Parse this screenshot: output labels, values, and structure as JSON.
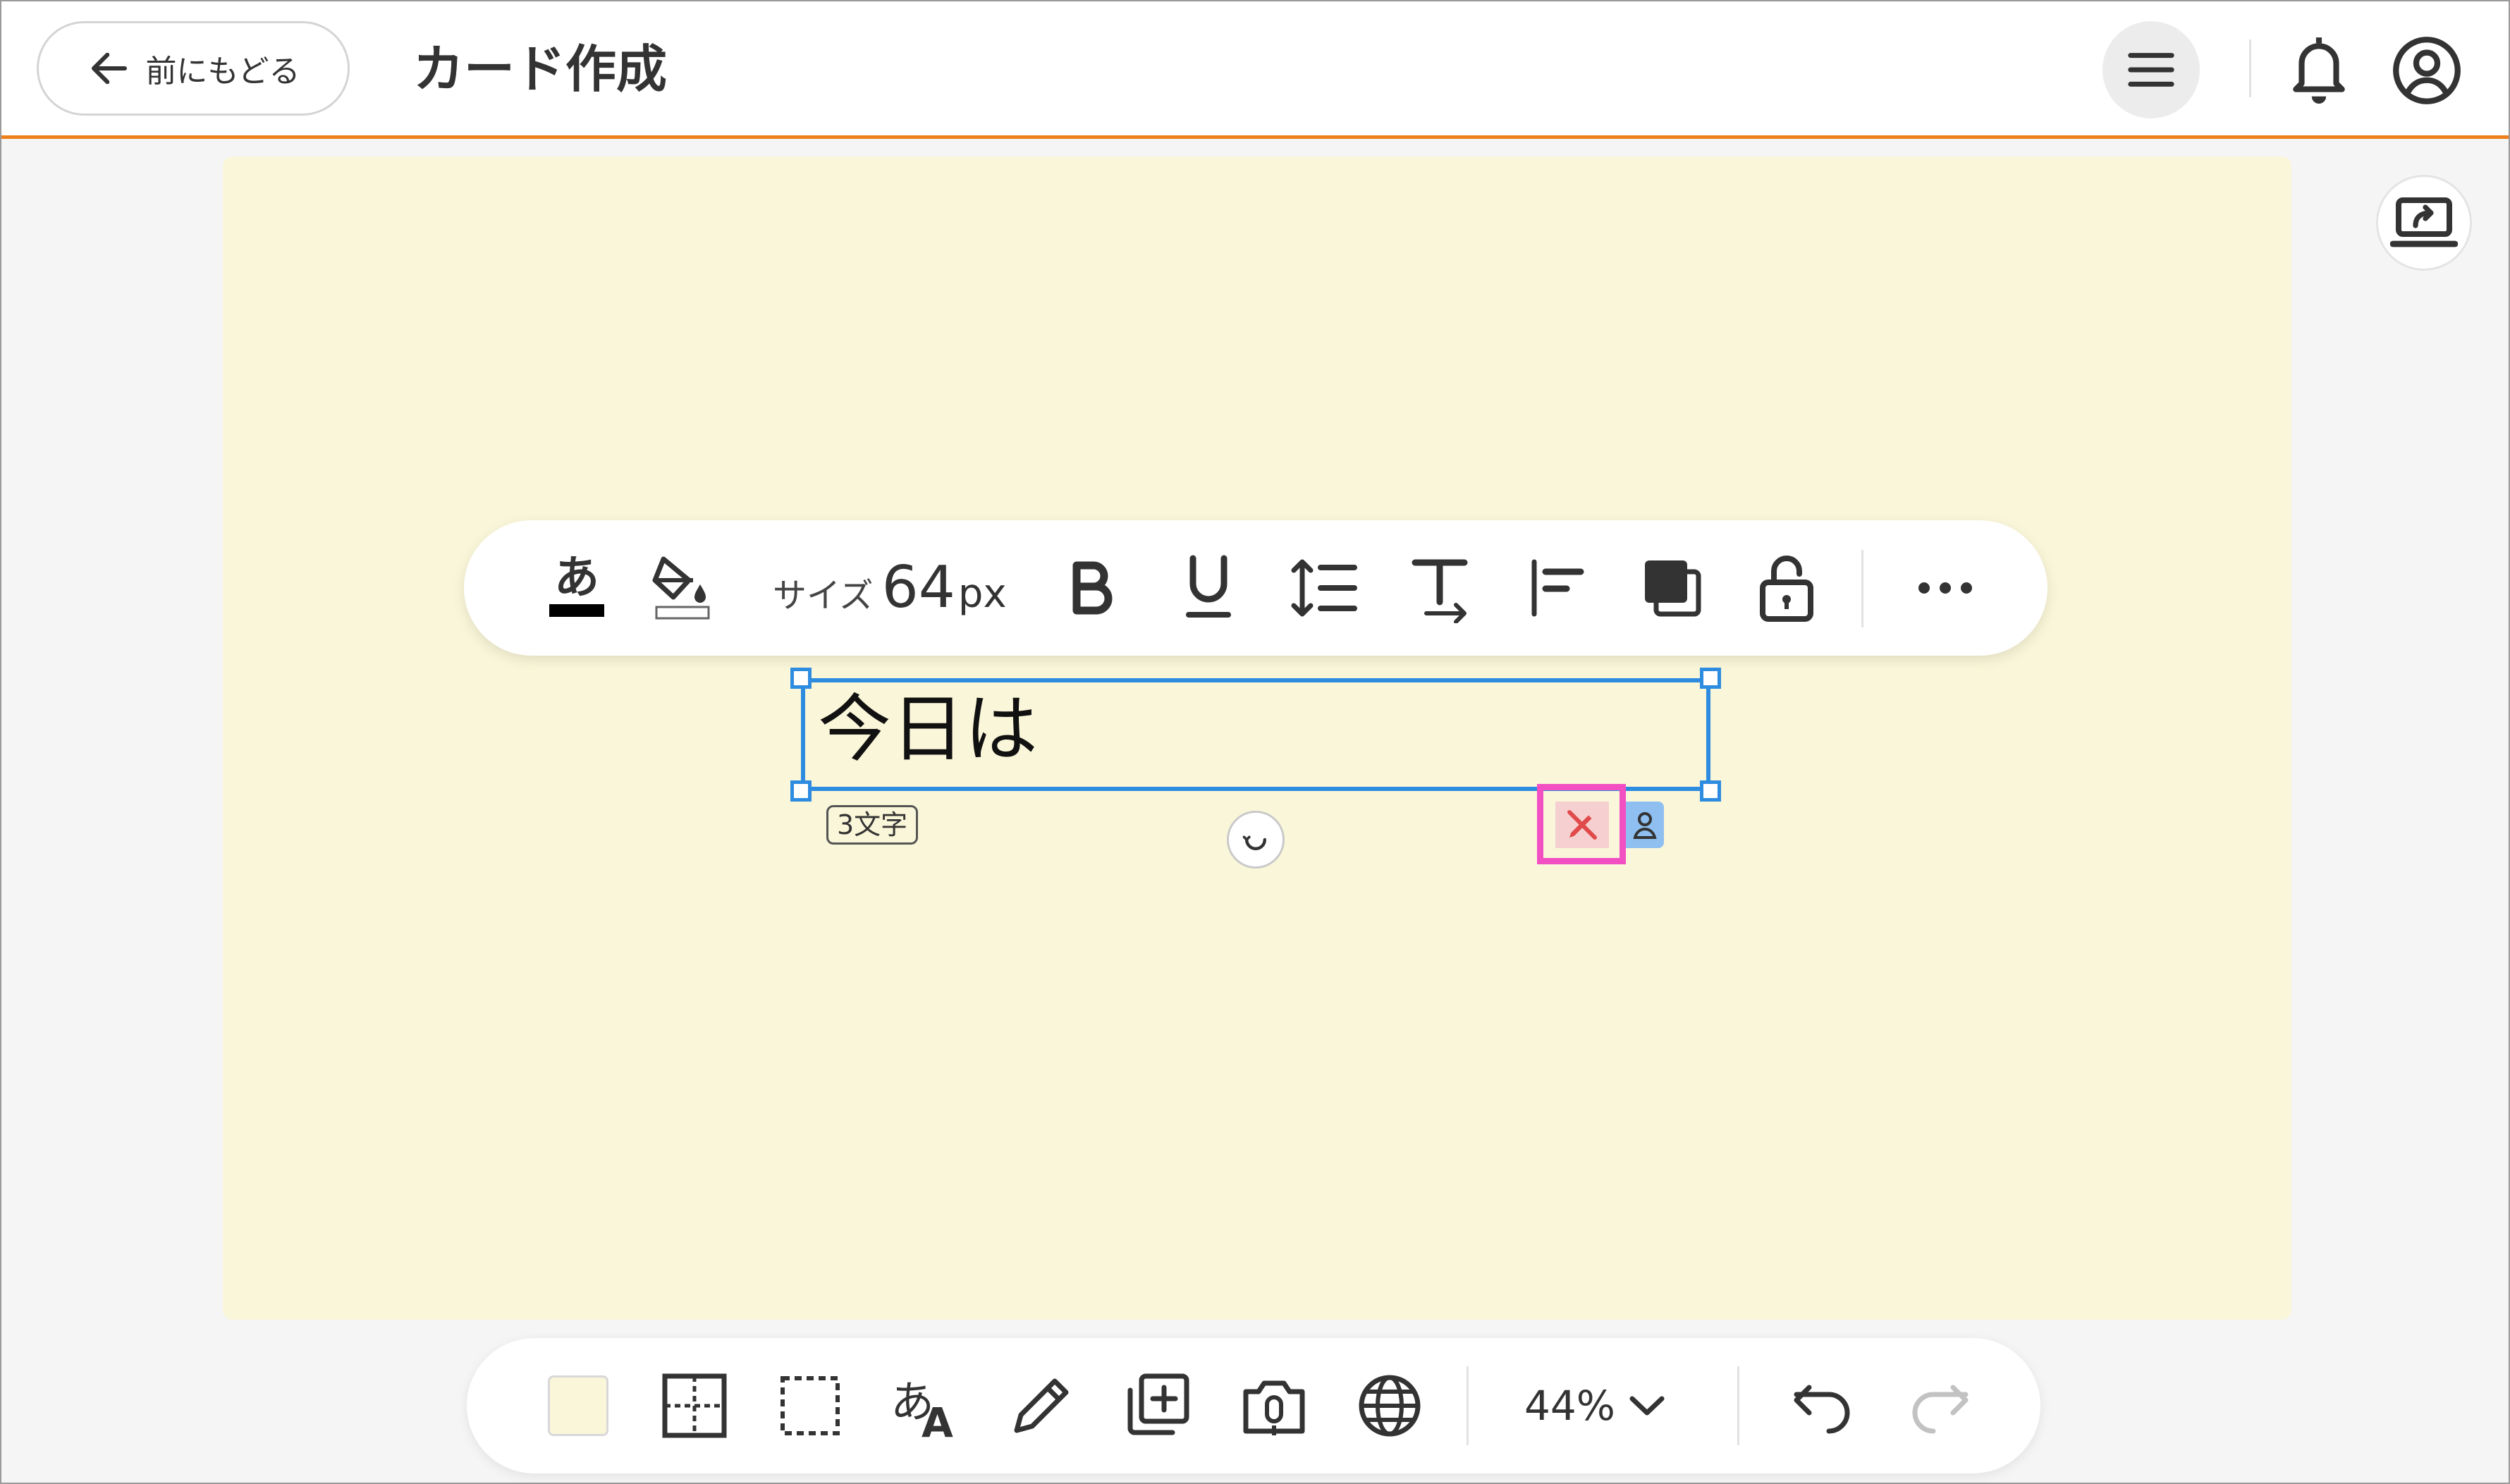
{
  "header": {
    "back_label": "前にもどる",
    "title": "カード作成"
  },
  "text_toolbar": {
    "size_label": "サイズ",
    "size_value": "64",
    "size_unit": "px"
  },
  "text_element": {
    "content": "今日は",
    "char_count": "3文字"
  },
  "bottom_toolbar": {
    "zoom": "44%"
  },
  "colors": {
    "accent": "#ee7f1a",
    "canvas_bg": "#faf6d9",
    "selection": "#2e8ce0",
    "highlight": "#f24fc3"
  }
}
